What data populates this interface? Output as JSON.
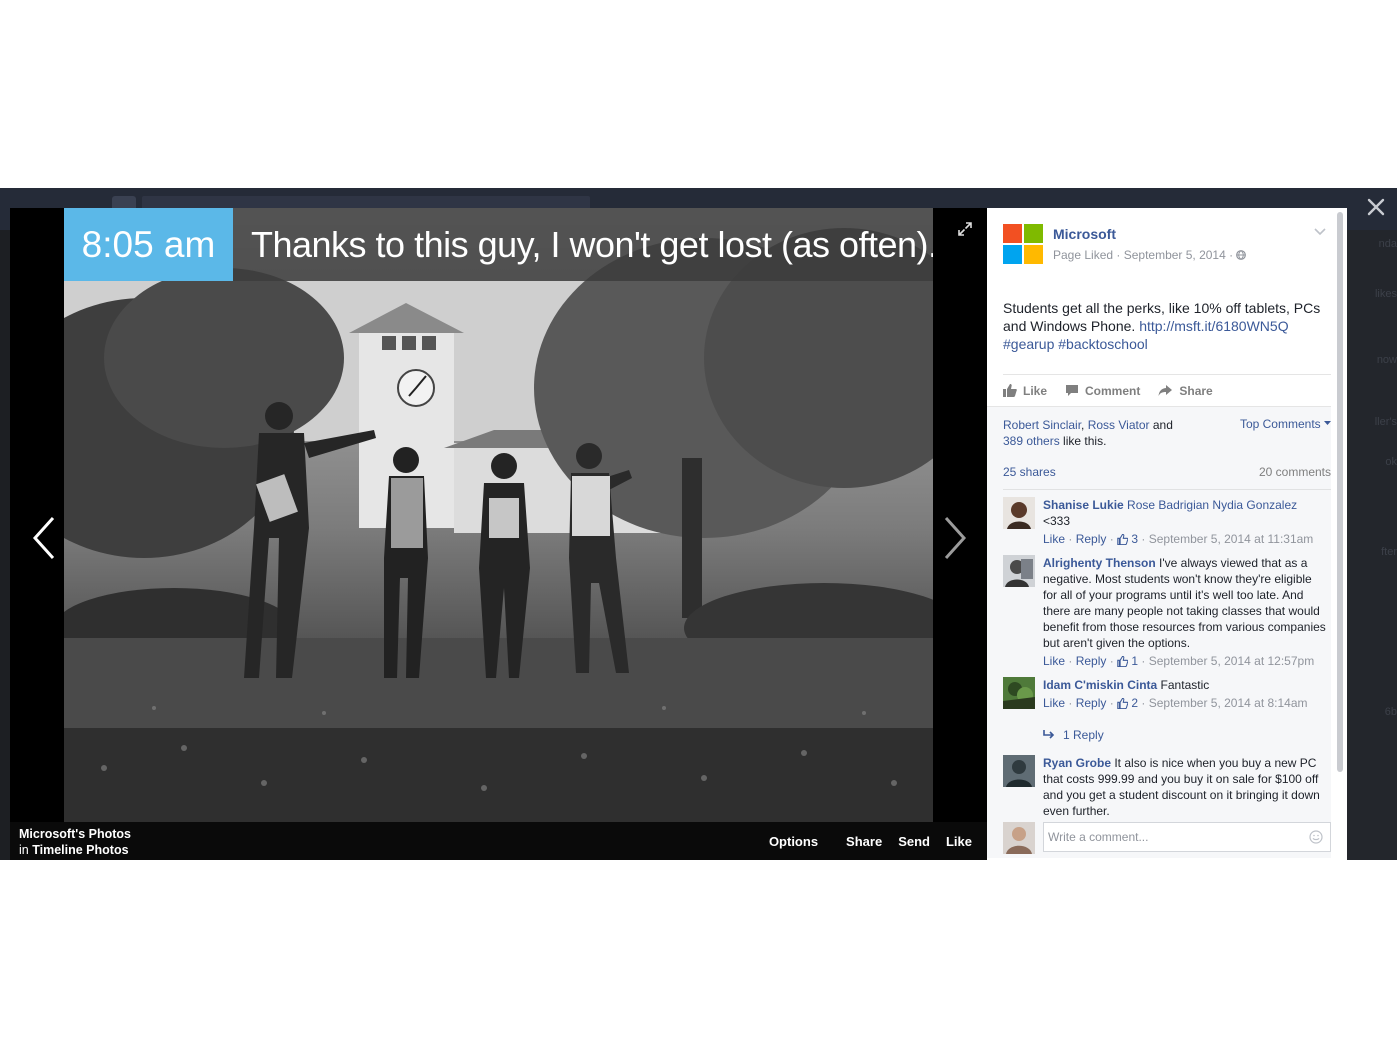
{
  "photo": {
    "time_label": "8:05 am",
    "caption": "Thanks to this guy, I won't get lost (as often).",
    "album_owner": "Microsoft's Photos",
    "album_prefix": "in",
    "album_name": "Timeline Photos"
  },
  "footer_actions": {
    "options": "Options",
    "share": "Share",
    "send": "Send",
    "like": "Like"
  },
  "post": {
    "page_name": "Microsoft",
    "meta": "Page Liked · September 5, 2014 · ",
    "text": "Students get all the perks, like 10% off tablets, PCs and Windows Phone. ",
    "link": "http://msft.it/6180WN5Q",
    "hashtags": "#gearup #backtoschool",
    "logo_colors": [
      "#f25022",
      "#7fba00",
      "#00a4ef",
      "#ffb900"
    ]
  },
  "actions": {
    "like": "Like",
    "comment": "Comment",
    "share": "Share"
  },
  "social": {
    "liker1": "Robert Sinclair",
    "comma": ", ",
    "liker2": "Ross Viator",
    "and": " and",
    "others": "389 others",
    "like_this": " like this.",
    "top_comments": "Top Comments",
    "shares": "25 shares",
    "comments_count": "20 comments"
  },
  "comments": [
    {
      "author": "Shanise Lukie",
      "text_mention": " Rose Badrigian Nydia Gonzalez",
      "text": "<333",
      "like": "Like",
      "reply": "Reply",
      "likes": "3",
      "time": "September 5, 2014 at 11:31am"
    },
    {
      "author": "Alrighenty Thenson",
      "text": " I've always viewed that as a negative. Most students won't know they're eligible for all of your programs until it's well too late. And there are many people not taking classes that would benefit from those resources from various companies but aren't given the options.",
      "like": "Like",
      "reply": "Reply",
      "likes": "1",
      "time": "September 5, 2014 at 12:57pm"
    },
    {
      "author": "Idam C'miskin Cinta",
      "text": " Fantastic",
      "like": "Like",
      "reply": "Reply",
      "likes": "2",
      "time": "September 5, 2014 at 8:14am",
      "replies_link": "1 Reply"
    },
    {
      "author": "Ryan Grobe",
      "text": " It also is nice when you buy a new PC that costs 999.99 and you buy it on sale for $100 off and you get a student discount on it bringing it down even further."
    }
  ],
  "composer": {
    "placeholder": "Write a comment..."
  },
  "background_hints": [
    "nda",
    "likes",
    "now",
    "ller's",
    "ok",
    "fter",
    "6b"
  ]
}
